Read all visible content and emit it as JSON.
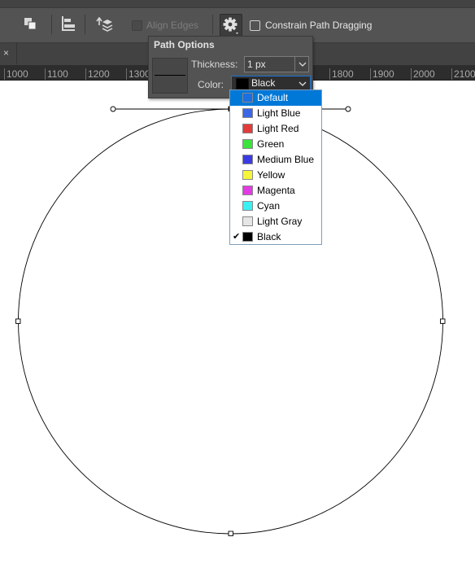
{
  "options_bar": {
    "align_edges_label": "Align Edges",
    "constrain_label": "Constrain Path Dragging",
    "icons": [
      "path-operations-icon",
      "path-alignment-icon",
      "path-arrangement-icon",
      "gear-icon"
    ]
  },
  "document_tab": {
    "close_glyph": "×"
  },
  "ruler": {
    "labels": [
      "1000",
      "1100",
      "1200",
      "1300",
      "1800",
      "1900",
      "2000",
      "2100"
    ]
  },
  "path_options": {
    "title": "Path Options",
    "thickness_label": "Thickness:",
    "thickness_value": "1 px",
    "color_label": "Color:",
    "color_value": "Black",
    "color_swatch": "#000000"
  },
  "color_menu": {
    "items": [
      {
        "label": "Default",
        "color": "#1a6fe3",
        "selected": true,
        "checked": false
      },
      {
        "label": "Light Blue",
        "color": "#3b66e6",
        "selected": false,
        "checked": false
      },
      {
        "label": "Light Red",
        "color": "#e33b3b",
        "selected": false,
        "checked": false
      },
      {
        "label": "Green",
        "color": "#3be33b",
        "selected": false,
        "checked": false
      },
      {
        "label": "Medium Blue",
        "color": "#3b3be3",
        "selected": false,
        "checked": false
      },
      {
        "label": "Yellow",
        "color": "#f5f53b",
        "selected": false,
        "checked": false
      },
      {
        "label": "Magenta",
        "color": "#e33be3",
        "selected": false,
        "checked": false
      },
      {
        "label": "Cyan",
        "color": "#3bf0f0",
        "selected": false,
        "checked": false
      },
      {
        "label": "Light Gray",
        "color": "#e6e6e6",
        "selected": false,
        "checked": false
      },
      {
        "label": "Black",
        "color": "#000000",
        "selected": false,
        "checked": true
      }
    ],
    "check_glyph": "✔"
  }
}
